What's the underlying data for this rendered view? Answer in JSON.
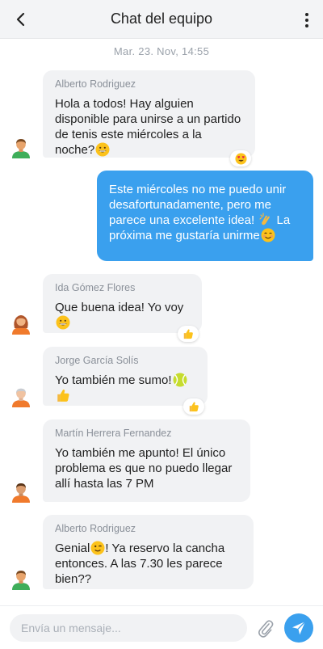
{
  "header": {
    "title": "Chat del equipo"
  },
  "date_label": "Mar. 23. Nov, 14:55",
  "messages": [
    {
      "sender": "Alberto Rodriguez",
      "text": "Hola a todos! Hay alguien disponible para unirse a un partido de tenis este miércoles a la noche?",
      "emoji": "grinning-face",
      "reaction": "heart-eyes",
      "avatar": "avatar-man-green"
    },
    {
      "text": "Este miércoles no me puedo unir desafortunadamente, pero me parece una excelente idea! ",
      "emoji": "clapping-hands",
      "text_after": " La próxima me gustaría unirme",
      "emoji2": "smiling-face"
    },
    {
      "sender": "Ida Gómez Flores",
      "text": "Que buena idea! Yo voy",
      "emoji": "grinning-face",
      "reaction": "thumbs-up",
      "avatar": "avatar-woman-orange"
    },
    {
      "sender": "Jorge García Solís",
      "text": "Yo también me sumo!",
      "emoji": "tennis-ball",
      "emoji2": "thumbs-up",
      "reaction": "thumbs-up",
      "avatar": "avatar-man-grey"
    },
    {
      "sender": "Martín Herrera Fernandez",
      "text": "Yo también me apunto! El único problema es que no puedo llegar allí hasta las 7 PM",
      "avatar": "avatar-man-orange"
    },
    {
      "sender": "Alberto Rodriguez",
      "text": "Genial",
      "emoji": "winking-face",
      "text_after": "! Ya reservo la cancha entonces. A las 7.30 les parece bien??",
      "avatar": "avatar-man-green"
    }
  ],
  "composer": {
    "placeholder": "Envía un mensaje..."
  },
  "colors": {
    "accent": "#3aa0ee",
    "bubble_in": "#f1f2f4",
    "header_bg": "#f3f4f6"
  }
}
